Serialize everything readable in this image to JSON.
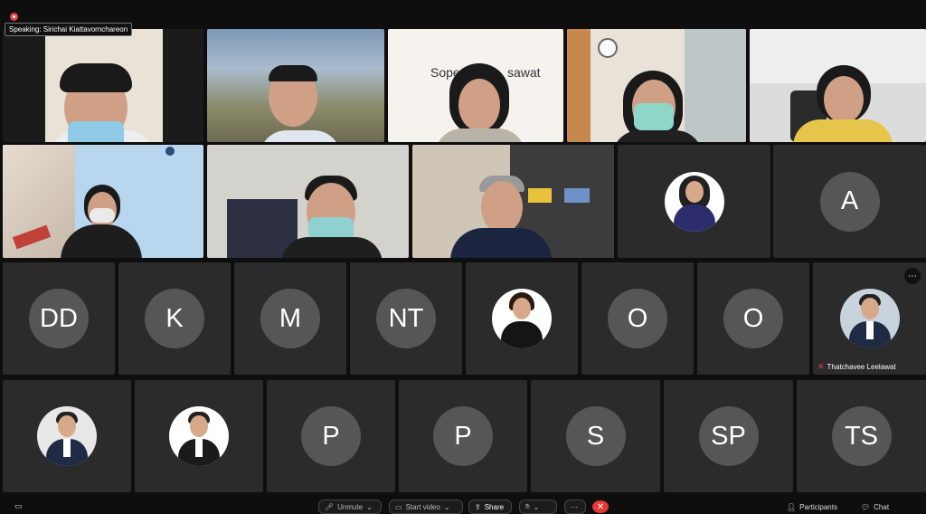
{
  "meeting": {
    "speaking_label": "Speaking: Sirichai Kiattavornchareon",
    "bg_name_text": "Sopee",
    "bg_name_text2": "sawat"
  },
  "tiles_row1_video": [
    "Video 1",
    "Video 2",
    "Video 3",
    "Video 4",
    "Video 5"
  ],
  "initials": {
    "r2_a": "A",
    "r3": [
      "DD",
      "K",
      "M",
      "NT",
      "O",
      "O"
    ],
    "r4": [
      "P",
      "P",
      "S",
      "SP",
      "TS"
    ]
  },
  "labels": {
    "thatchavee": "Thatchavee Leelawat"
  },
  "toolbar": {
    "unmute": "Unmute",
    "start_video": "Start video",
    "share": "Share",
    "participants": "Participants",
    "chat": "Chat"
  },
  "colors": {
    "accent_red": "#e53935",
    "tile_bg": "#2b2b2b"
  }
}
